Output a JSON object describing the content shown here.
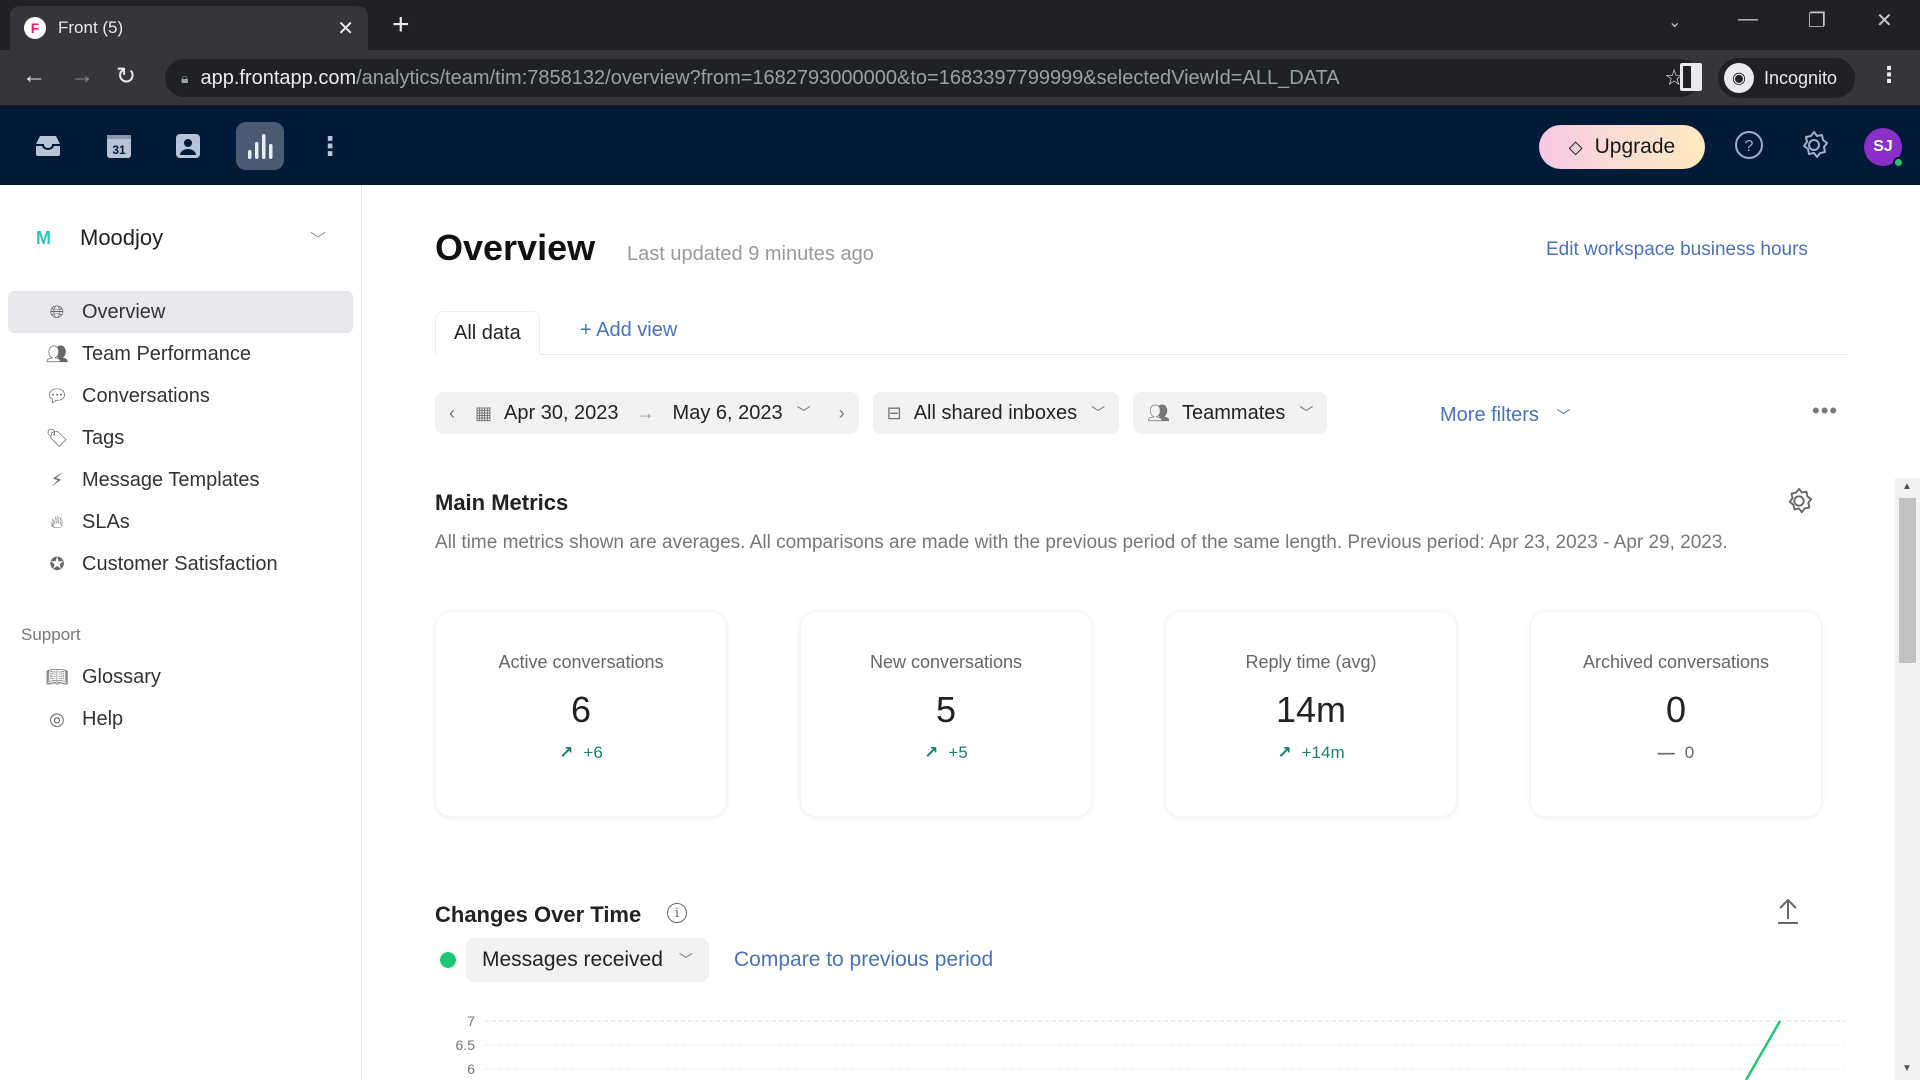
{
  "browser": {
    "tab_title": "Front (5)",
    "url_host": "app.frontapp.com",
    "url_path": "/analytics/team/tim:7858132/overview?from=1682793000000&to=1683397799999&selectedViewId=ALL_DATA",
    "profile_label": "Incognito"
  },
  "appbar": {
    "upgrade_label": "Upgrade",
    "avatar_initials": "SJ",
    "calendar_day": "31"
  },
  "sidebar": {
    "workspace_initial": "M",
    "workspace_name": "Moodjoy",
    "items": [
      {
        "label": "Overview",
        "icon": "globe-icon"
      },
      {
        "label": "Team Performance",
        "icon": "users-icon"
      },
      {
        "label": "Conversations",
        "icon": "chat-bubble-icon"
      },
      {
        "label": "Tags",
        "icon": "tag-icon"
      },
      {
        "label": "Message Templates",
        "icon": "template-icon"
      },
      {
        "label": "SLAs",
        "icon": "flame-icon"
      },
      {
        "label": "Customer Satisfaction",
        "icon": "star-badge-icon"
      }
    ],
    "support_label": "Support",
    "support_items": [
      {
        "label": "Glossary",
        "icon": "book-icon"
      },
      {
        "label": "Help",
        "icon": "lifebuoy-icon"
      }
    ]
  },
  "main": {
    "title": "Overview",
    "last_updated": "Last updated 9 minutes ago",
    "edit_hours_link": "Edit workspace business hours",
    "tabs": [
      {
        "label": "All data",
        "active": true
      },
      {
        "label": "+ Add view",
        "active": false
      }
    ],
    "filters": {
      "date_from": "Apr 30, 2023",
      "date_to": "May 6, 2023",
      "inboxes": "All shared inboxes",
      "teammates": "Teammates",
      "more_filters": "More filters"
    },
    "main_metrics": {
      "title": "Main Metrics",
      "description": "All time metrics shown are averages. All comparisons are made with the previous period of the same length. Previous period: Apr 23, 2023 - Apr 29, 2023.",
      "cards": [
        {
          "label": "Active conversations",
          "value": "6",
          "delta": "+6",
          "trend": "up"
        },
        {
          "label": "New conversations",
          "value": "5",
          "delta": "+5",
          "trend": "up"
        },
        {
          "label": "Reply time (avg)",
          "value": "14m",
          "delta": "+14m",
          "trend": "up"
        },
        {
          "label": "Archived conversations",
          "value": "0",
          "delta": "0",
          "trend": "flat"
        }
      ]
    },
    "changes_over_time": {
      "title": "Changes Over Time",
      "metric_selected": "Messages received",
      "series_color": "#22c776",
      "compare_link": "Compare to previous period",
      "y_ticks": [
        "7",
        "6.5",
        "6"
      ]
    }
  }
}
